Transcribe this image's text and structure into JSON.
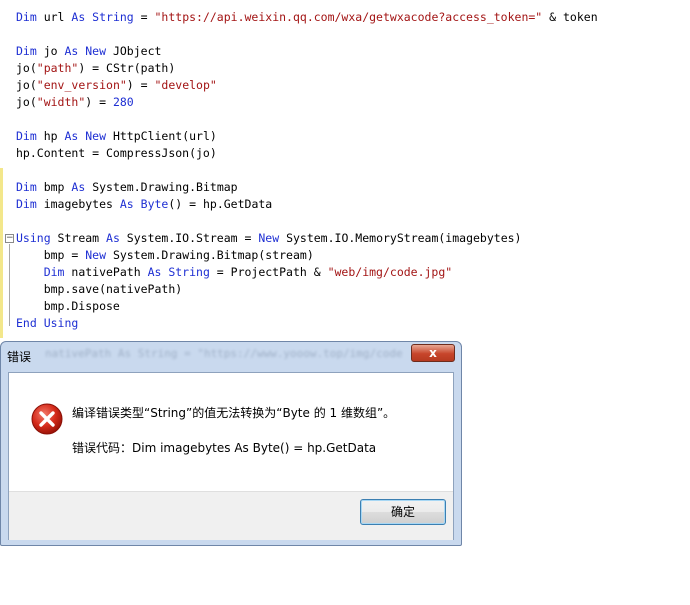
{
  "code": {
    "l1": {
      "a": "Dim",
      "b": " url ",
      "c": "As String",
      "d": " = ",
      "e": "\"https://api.weixin.qq.com/wxa/getwxacode?access_token=\"",
      "f": " & token"
    },
    "l2": {
      "a": "Dim",
      "b": " jo ",
      "c": "As New",
      "d": " JObject"
    },
    "l3": {
      "a": "jo(",
      "b": "\"path\"",
      "c": ") = CStr(path)"
    },
    "l4": {
      "a": "jo(",
      "b": "\"env_version\"",
      "c": ") = ",
      "d": "\"develop\""
    },
    "l5": {
      "a": "jo(",
      "b": "\"width\"",
      "c": ") = ",
      "d": "280"
    },
    "l6": {
      "a": "Dim",
      "b": " hp ",
      "c": "As New",
      "d": " HttpClient(url)"
    },
    "l7": {
      "a": "hp.Content = CompressJson(jo)"
    },
    "l8": {
      "a": "Dim",
      "b": " bmp ",
      "c": "As",
      "d": " System.Drawing.Bitmap"
    },
    "l9": {
      "a": "Dim",
      "b": " imagebytes ",
      "c": "As",
      "d": " Byte",
      "e": "() = hp.GetData"
    },
    "l10": {
      "a": "Using",
      "b": " Stream ",
      "c": "As",
      "d": " System.IO.Stream = ",
      "e": "New",
      "f": " System.IO.MemoryStream(imagebytes)"
    },
    "l11": {
      "a": "    bmp = ",
      "b": "New",
      "c": " System.Drawing.Bitmap(stream)"
    },
    "l12": {
      "a": "    Dim",
      "b": " nativePath ",
      "c": "As String",
      "d": " = ProjectPath & ",
      "e": "\"web/img/code.jpg\""
    },
    "l13": {
      "a": "    bmp.save(nativePath)"
    },
    "l14": {
      "a": "    bmp.Dispose"
    },
    "l15": {
      "a": "End Using"
    },
    "collapse_symbol": "−"
  },
  "dialog": {
    "title": "错误",
    "ghost_text": "nativePath As String = \"https://www.yooow.top/img/code",
    "close_symbol": "x",
    "message": "编译错误类型“String”的值无法转换为“Byte 的 1 维数组”。",
    "detail": "错误代码：Dim imagebytes As Byte() = hp.GetData",
    "ok_label": "确定",
    "icon": "error-icon"
  },
  "colors": {
    "keyword": "#1e2fd3",
    "string": "#a31515",
    "dialog_frame": "#c9d9ee",
    "close_button": "#c7452b"
  }
}
